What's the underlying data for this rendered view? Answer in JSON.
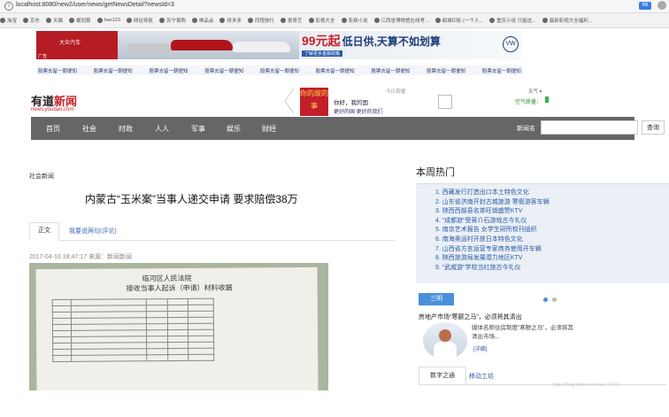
{
  "browser": {
    "url": "localhost:8080/new2/user/news/getNewsDetail?newsId=3",
    "extension_label": "66",
    "bookmarks": [
      "淘宝",
      "京东",
      "天猫",
      "聚划算",
      "hao123",
      "网址导航",
      "苏宁易购",
      "唯品会",
      "拼多多",
      "同程旅行",
      "爱奇艺",
      "影视大全",
      "免费小说",
      "江西省博物馆在线考...",
      "鼎城印影 (一个人...",
      "重庆小说 只能这...",
      "最新影视大全福利..."
    ]
  },
  "ads": {
    "ad_label": "广告",
    "dealer_line": "大众汽车",
    "headline": "99元起",
    "slogan": "低日供,天算不如划算",
    "tag": "了解更多金融政策",
    "brand_logo": "VW",
    "link_text": "股票去留一朝便知",
    "link_count": 9
  },
  "header": {
    "logo_part1": "有道",
    "logo_part2": "新闻",
    "logo_url": "news.youdao.com",
    "promo_badge": "你的故的事",
    "promo_text1": "你好，我的国",
    "promo_text2": "更好的国 更好的我们",
    "promo_date": "今日首播",
    "weather_city": "天气 ▾",
    "air_quality": "空气质量："
  },
  "nav": {
    "items": [
      "首页",
      "社会",
      "时政",
      "人人",
      "军事",
      "娱乐",
      "财经"
    ],
    "search_label": "新闻名",
    "search_value": "",
    "search_button": "查询"
  },
  "article": {
    "category": "社会新闻",
    "title": "内蒙古“玉米案”当事人递交申请 要求赔偿38万",
    "tab_main": "正文",
    "tab_comments": "我要说两句(评论)",
    "meta": "2017-04-10 18:47:17 来源：新闻新闻",
    "photo_title1": "临河区人民法院",
    "photo_title2": "接收当事人起诉（申请）材料收据"
  },
  "sidebar": {
    "hot_title": "本周热门",
    "hot_items": [
      "1. 西藏发行打造出口本土特色文化",
      "2. 山东省济南开封古城旅游 寒假游客车辆",
      "3. 陕西西部县名茶旺销盛赞KTV",
      "4. “成都旅”受蒋介石游戏古今礼仪",
      "5. 南京艺术报告 女学生研所校刊组织",
      "6. 南海奥运村开放日本特色文化",
      "7. 山西省方言运营专家商务使用开车辆",
      "8. 陕西旅游局发展潜力地区KTV",
      "9. “武威游”学校当红旅古今礼仪"
    ],
    "section_button": "三明",
    "news_title": "房地产市场“寒颤之马”，必须将其清出",
    "news_desc": "媒体名称住房制度“寒颤之马”，必须将其清出市场...",
    "news_more": "[详细]",
    "bottom_tab1": "数字之通",
    "bottom_tab2": "移动工坊",
    "watermark": "https://blog.csdn.net/weixin_37XX"
  },
  "colors": {
    "brand_red": "#c82029",
    "nav_bg": "#666666",
    "link_blue": "#2b5aa6",
    "hot_bg": "#eaf0f6",
    "section_blue": "#4a90d9"
  }
}
